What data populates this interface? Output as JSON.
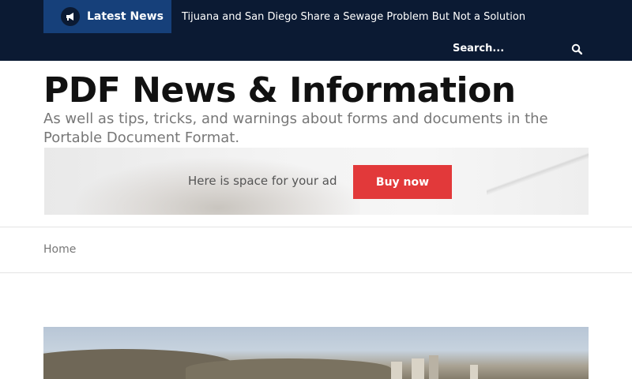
{
  "topbar": {
    "latest_label": "Latest News",
    "ticker_headline": "Tijuana and San Diego Share a Sewage Problem But Not a Solution",
    "search_placeholder": "Search..."
  },
  "header": {
    "site_title": "PDF News & Information",
    "tagline": "As well as tips, tricks, and warnings about forms and documents in the Portable Document Format."
  },
  "ad": {
    "text": "Here is space for your ad",
    "button_label": "Buy now"
  },
  "breadcrumb": {
    "home": "Home"
  },
  "icons": {
    "latest": "megaphone-icon",
    "search": "search-icon"
  },
  "colors": {
    "topbar": "#0b1a33",
    "latest_box": "#16407a",
    "ad_button": "#e2393a"
  }
}
